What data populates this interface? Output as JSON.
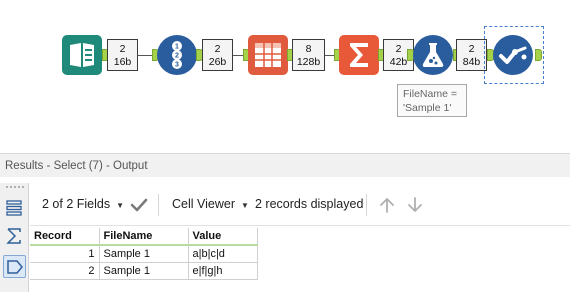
{
  "workflow": {
    "badges": [
      {
        "count": "2",
        "size": "16b"
      },
      {
        "count": "2",
        "size": "26b"
      },
      {
        "count": "8",
        "size": "128b"
      },
      {
        "count": "2",
        "size": "42b"
      },
      {
        "count": "2",
        "size": "84b"
      }
    ],
    "annotation_line1": "FileName =",
    "annotation_line2": "'Sample 1'",
    "colors": {
      "input_tool": "#1f8a7a",
      "record_id_tool": "#2a5d9e",
      "table_tool": "#e05a3e",
      "summarize_tool": "#e8593a",
      "formula_tool": "#2a5d9e",
      "select_tool": "#2a5d9e",
      "port": "#a6d24a"
    },
    "icons": [
      "input-data-icon",
      "record-id-icon",
      "text-to-columns-icon",
      "summarize-icon",
      "formula-icon",
      "select-icon"
    ]
  },
  "results": {
    "title": "Results - Select (7) - Output",
    "fields_label": "2 of 2 Fields",
    "viewer_label": "Cell Viewer",
    "records_label": "2 records displayed",
    "columns": [
      "Record",
      "FileName",
      "Value"
    ],
    "rows": [
      {
        "record": "1",
        "filename": "Sample 1",
        "value": "a|b|c|d"
      },
      {
        "record": "2",
        "filename": "Sample 1",
        "value": "e|f|g|h"
      }
    ]
  }
}
